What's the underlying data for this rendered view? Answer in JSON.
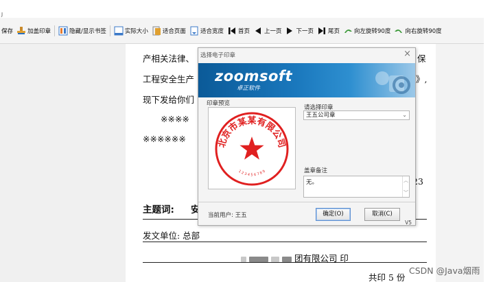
{
  "top_mark": "J",
  "toolbar": {
    "items": [
      {
        "label": "保存",
        "icon": "save-icon"
      },
      {
        "label": "加盖印章",
        "icon": "stamp-icon"
      },
      {
        "label": "隐藏/显示书签",
        "icon": "bookmark-icon"
      },
      {
        "label": "实际大小",
        "icon": "actual-size-icon"
      },
      {
        "label": "适合页面",
        "icon": "fit-page-icon"
      },
      {
        "label": "适合宽度",
        "icon": "fit-width-icon"
      },
      {
        "label": "首页",
        "icon": "first-page-icon"
      },
      {
        "label": "上一页",
        "icon": "prev-page-icon"
      },
      {
        "label": "下一页",
        "icon": "next-page-icon"
      },
      {
        "label": "尾页",
        "icon": "last-page-icon"
      },
      {
        "label": "向左旋转90度",
        "icon": "rotate-left-icon"
      },
      {
        "label": "向右旋转90度",
        "icon": "rotate-right-icon"
      }
    ]
  },
  "document": {
    "line1": "产相关法律、",
    "line1_tail": "保",
    "line2": "工程安全生产",
    "line2_tail": "》,",
    "line3": "现下发给你们",
    "line4": "※※※※",
    "line5": "※※※※※※",
    "number_tail": "23",
    "subject_label": "主题词:",
    "subject_tail": "安",
    "issuer": "发文单位:  总部",
    "company_tail": "团有限公司   印",
    "copies": "共印 5 份"
  },
  "dialog": {
    "title": "选择电子印章",
    "brand": "zoomsoft",
    "brand_sub": "卓正软件",
    "preview_label": "印章预览",
    "select_label": "请选择印章",
    "selected_seal": "王五公司章",
    "note_label": "盖章备注",
    "note_value": "无。",
    "current_user": "当前用户:  王五",
    "ok_label": "确定(O)",
    "cancel_label": "取消(C)",
    "version": "V5"
  },
  "seal": {
    "text": "北京市某某有限公司",
    "code": "1 2 3 4 5 6 7 8 9",
    "color": "#e02020"
  },
  "watermark": "CSDN @Java烟雨",
  "colors": {
    "banner": "#1a78bd",
    "seal": "#e02020",
    "ok_border": "#5d8fd0"
  }
}
